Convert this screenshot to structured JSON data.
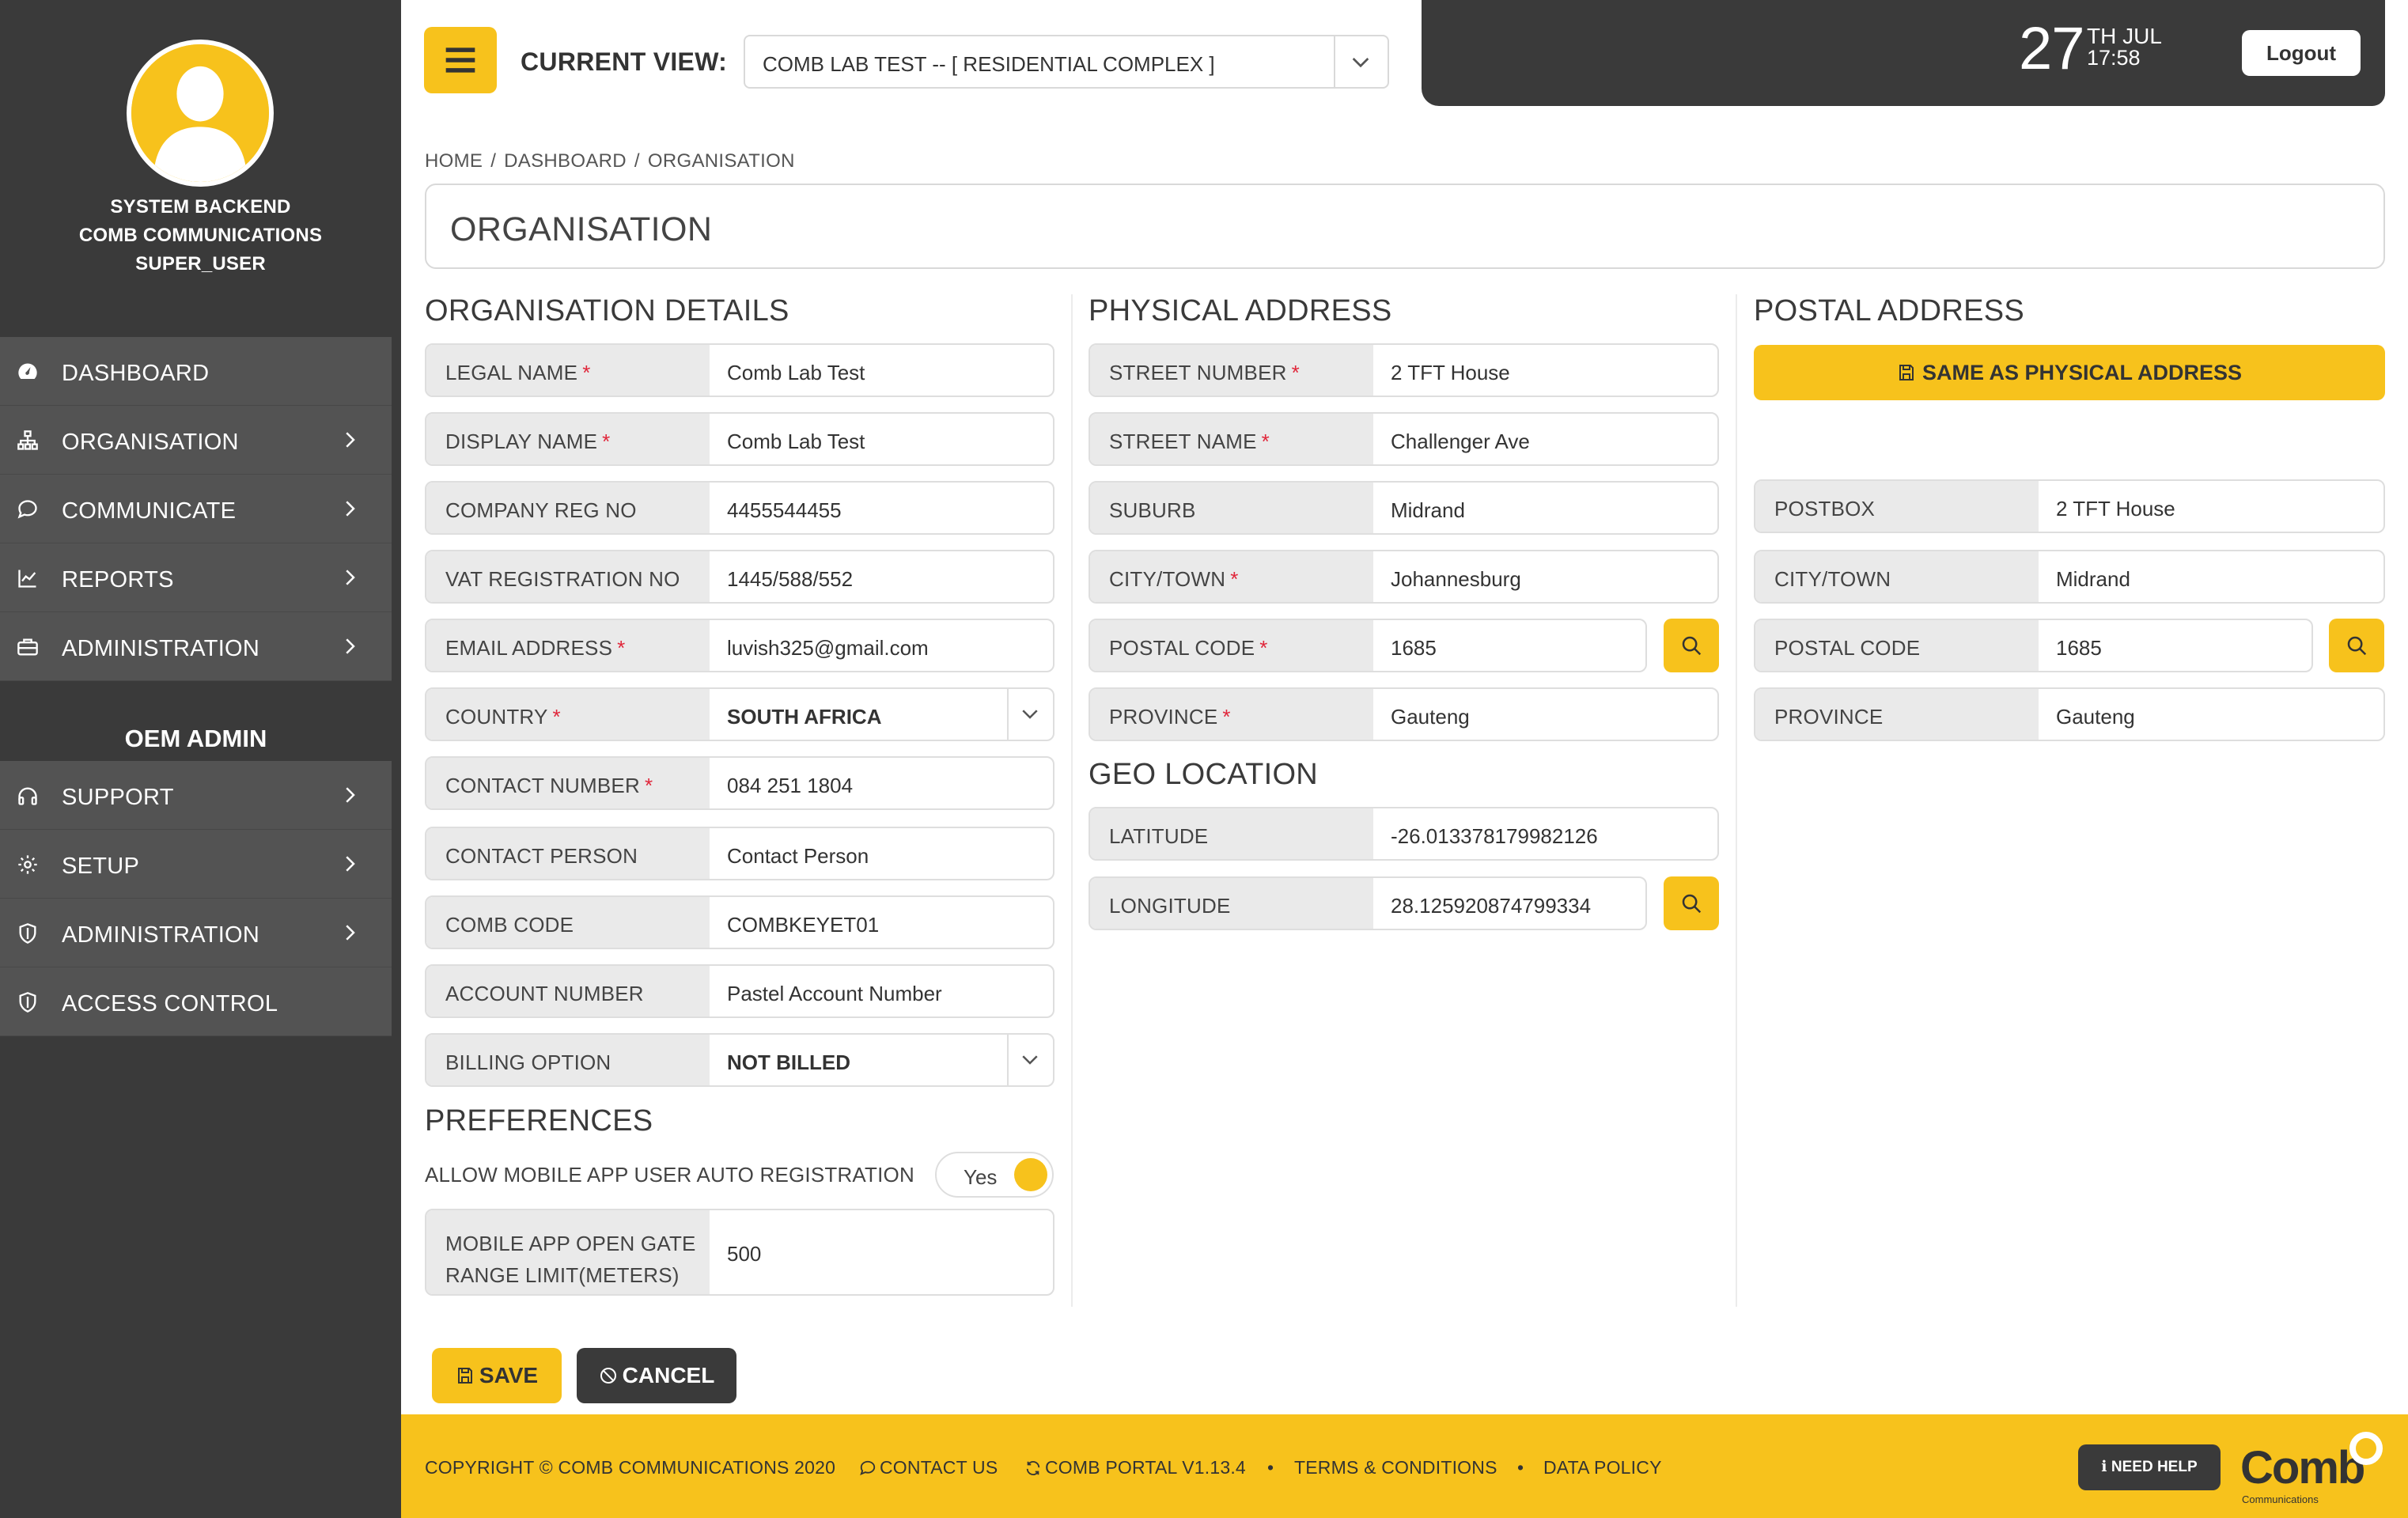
{
  "user": {
    "line1": "SYSTEM BACKEND",
    "line2": "COMB COMMUNICATIONS",
    "line3": "SUPER_USER"
  },
  "nav": {
    "items": [
      {
        "label": "DASHBOARD",
        "icon": "dashboard-icon"
      },
      {
        "label": "ORGANISATION",
        "icon": "org-chart-icon"
      },
      {
        "label": "COMMUNICATE",
        "icon": "chat-icon"
      },
      {
        "label": "REPORTS",
        "icon": "chart-icon"
      },
      {
        "label": "ADMINISTRATION",
        "icon": "briefcase-icon"
      }
    ],
    "oem_title": "OEM ADMIN",
    "oem_items": [
      {
        "label": "SUPPORT",
        "icon": "headphones-icon"
      },
      {
        "label": "SETUP",
        "icon": "gear-icon"
      },
      {
        "label": "ADMINISTRATION",
        "icon": "shield-icon"
      },
      {
        "label": "ACCESS CONTROL",
        "icon": "shield-icon"
      }
    ]
  },
  "topbar": {
    "current_view_label": "CURRENT VIEW:",
    "current_view_value": "COMB LAB TEST -- [ RESIDENTIAL COMPLEX ]",
    "date_day": "27",
    "date_month": "TH JUL",
    "time": "17:58",
    "logout": "Logout"
  },
  "breadcrumb": {
    "home": "HOME",
    "dashboard": "DASHBOARD",
    "current": "ORGANISATION"
  },
  "page_title": "ORGANISATION",
  "org_details": {
    "title": "ORGANISATION DETAILS",
    "legal_name": {
      "label": "LEGAL NAME",
      "value": "Comb Lab Test"
    },
    "display_name": {
      "label": "DISPLAY NAME",
      "value": "Comb Lab Test"
    },
    "company_reg": {
      "label": "COMPANY REG NO",
      "value": "4455544455"
    },
    "vat_reg": {
      "label": "VAT REGISTRATION NO",
      "value": "1445/588/552"
    },
    "email": {
      "label": "EMAIL ADDRESS",
      "value": "luvish325@gmail.com"
    },
    "country": {
      "label": "COUNTRY",
      "value": "SOUTH AFRICA"
    },
    "contact_number": {
      "label": "CONTACT NUMBER",
      "value": "084 251 1804"
    },
    "contact_person": {
      "label": "CONTACT PERSON",
      "value": "Contact Person"
    },
    "comb_code": {
      "label": "COMB CODE",
      "value": "COMBKEYET01"
    },
    "account_number": {
      "label": "ACCOUNT NUMBER",
      "value": "Pastel Account Number"
    },
    "billing_option": {
      "label": "BILLING OPTION",
      "value": "NOT BILLED"
    }
  },
  "preferences": {
    "title": "PREFERENCES",
    "auto_reg_label": "ALLOW MOBILE APP USER AUTO REGISTRATION",
    "auto_reg_value": "Yes",
    "gate_range": {
      "label": "MOBILE APP OPEN GATE RANGE LIMIT(METERS)",
      "value": "500"
    }
  },
  "physical": {
    "title": "PHYSICAL ADDRESS",
    "street_number": {
      "label": "STREET NUMBER",
      "value": "2 TFT House"
    },
    "street_name": {
      "label": "STREET NAME",
      "value": "Challenger Ave"
    },
    "suburb": {
      "label": "SUBURB",
      "value": "Midrand"
    },
    "city": {
      "label": "CITY/TOWN",
      "value": "Johannesburg"
    },
    "postal_code": {
      "label": "POSTAL CODE",
      "value": "1685"
    },
    "province": {
      "label": "PROVINCE",
      "value": "Gauteng"
    }
  },
  "geo": {
    "title": "GEO LOCATION",
    "latitude": {
      "label": "LATITUDE",
      "value": "-26.013378179982126"
    },
    "longitude": {
      "label": "LONGITUDE",
      "value": "28.125920874799334"
    }
  },
  "postal": {
    "title": "POSTAL ADDRESS",
    "same_as_button": "SAME AS PHYSICAL ADDRESS",
    "postbox": {
      "label": "POSTBOX",
      "value": "2 TFT House"
    },
    "city": {
      "label": "CITY/TOWN",
      "value": "Midrand"
    },
    "postal_code": {
      "label": "POSTAL CODE",
      "value": "1685"
    },
    "province": {
      "label": "PROVINCE",
      "value": "Gauteng"
    }
  },
  "actions": {
    "save": "SAVE",
    "cancel": "CANCEL"
  },
  "footer": {
    "copyright": "COPYRIGHT © COMB COMMUNICATIONS 2020",
    "contact": "CONTACT US",
    "portal": "COMB PORTAL V1.13.4",
    "bullet": "•",
    "terms": "TERMS & CONDITIONS",
    "data_policy": "DATA POLICY",
    "help": "NEED HELP",
    "logo": "Comb",
    "logo_sub": "Communications"
  },
  "colors": {
    "accent": "#f7c21c",
    "sidebar": "#3a3a3a",
    "required": "#e0263a"
  }
}
